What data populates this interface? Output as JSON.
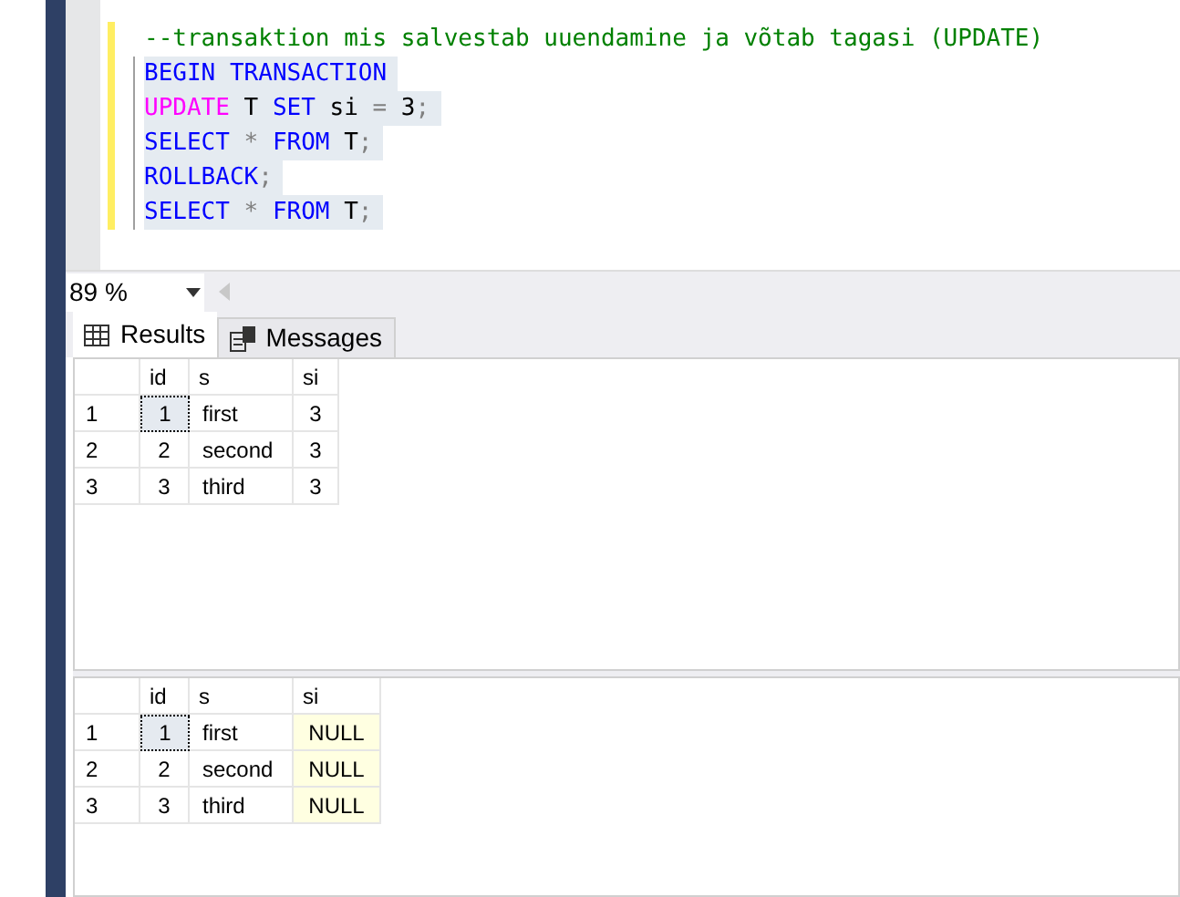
{
  "editor": {
    "lines": [
      {
        "selected": false,
        "tokens": [
          {
            "text": "--transaktion mis salvestab uuendamine ja võtab tagasi (UPDATE)",
            "kind": "comment"
          }
        ]
      },
      {
        "selected": true,
        "tokens": [
          {
            "text": "BEGIN TRANSACTION",
            "kind": "keyword"
          }
        ]
      },
      {
        "selected": true,
        "tokens": [
          {
            "text": "UPDATE",
            "kind": "function"
          },
          {
            "text": " T ",
            "kind": "plain"
          },
          {
            "text": "SET",
            "kind": "keyword"
          },
          {
            "text": " si ",
            "kind": "plain"
          },
          {
            "text": "=",
            "kind": "operator"
          },
          {
            "text": " 3",
            "kind": "plain"
          },
          {
            "text": ";",
            "kind": "operator"
          }
        ]
      },
      {
        "selected": true,
        "tokens": [
          {
            "text": "SELECT",
            "kind": "keyword"
          },
          {
            "text": " * ",
            "kind": "operator"
          },
          {
            "text": "FROM",
            "kind": "keyword"
          },
          {
            "text": " T",
            "kind": "plain"
          },
          {
            "text": ";",
            "kind": "operator"
          }
        ]
      },
      {
        "selected": true,
        "tokens": [
          {
            "text": "ROLLBACK",
            "kind": "keyword"
          },
          {
            "text": ";",
            "kind": "operator"
          }
        ]
      },
      {
        "selected": true,
        "tokens": [
          {
            "text": "SELECT",
            "kind": "keyword"
          },
          {
            "text": " * ",
            "kind": "operator"
          },
          {
            "text": "FROM",
            "kind": "keyword"
          },
          {
            "text": " T",
            "kind": "plain"
          },
          {
            "text": ";",
            "kind": "operator"
          }
        ]
      }
    ]
  },
  "zoom": {
    "value": "89 %"
  },
  "tabs": [
    {
      "label": "Results",
      "selected": true
    },
    {
      "label": "Messages",
      "selected": false
    }
  ],
  "grids": [
    {
      "columns": [
        "id",
        "s",
        "si"
      ],
      "rows": [
        {
          "number": "1",
          "cells": [
            {
              "text": "1",
              "kind": "value",
              "selected": true
            },
            {
              "text": "first",
              "kind": "value",
              "selected": false
            },
            {
              "text": "3",
              "kind": "value",
              "selected": false
            }
          ]
        },
        {
          "number": "2",
          "cells": [
            {
              "text": "2",
              "kind": "value",
              "selected": false
            },
            {
              "text": "second",
              "kind": "value",
              "selected": false
            },
            {
              "text": "3",
              "kind": "value",
              "selected": false
            }
          ]
        },
        {
          "number": "3",
          "cells": [
            {
              "text": "3",
              "kind": "value",
              "selected": false
            },
            {
              "text": "third",
              "kind": "value",
              "selected": false
            },
            {
              "text": "3",
              "kind": "value",
              "selected": false
            }
          ]
        }
      ]
    },
    {
      "columns": [
        "id",
        "s",
        "si"
      ],
      "rows": [
        {
          "number": "1",
          "cells": [
            {
              "text": "1",
              "kind": "value",
              "selected": true
            },
            {
              "text": "first",
              "kind": "value",
              "selected": false
            },
            {
              "text": "NULL",
              "kind": "null",
              "selected": false
            }
          ]
        },
        {
          "number": "2",
          "cells": [
            {
              "text": "2",
              "kind": "value",
              "selected": false
            },
            {
              "text": "second",
              "kind": "value",
              "selected": false
            },
            {
              "text": "NULL",
              "kind": "null",
              "selected": false
            }
          ]
        },
        {
          "number": "3",
          "cells": [
            {
              "text": "3",
              "kind": "value",
              "selected": false
            },
            {
              "text": "third",
              "kind": "value",
              "selected": false
            },
            {
              "text": "NULL",
              "kind": "null",
              "selected": false
            }
          ]
        }
      ]
    }
  ]
}
